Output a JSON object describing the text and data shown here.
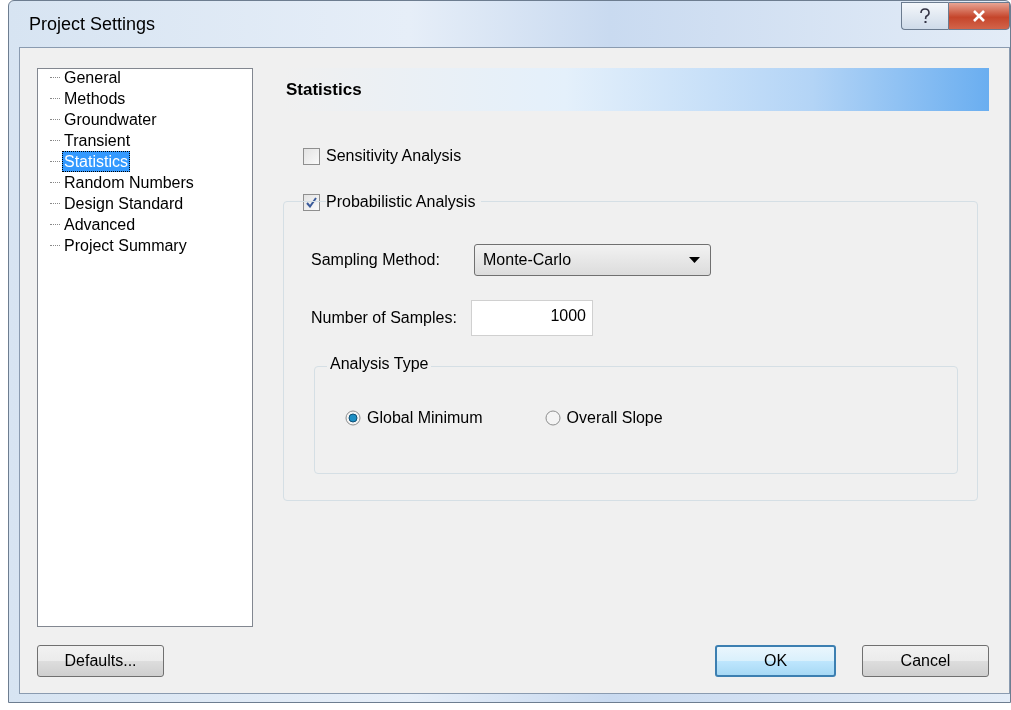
{
  "window": {
    "title": "Project Settings"
  },
  "tree": {
    "items": [
      {
        "label": "General",
        "selected": false
      },
      {
        "label": "Methods",
        "selected": false
      },
      {
        "label": "Groundwater",
        "selected": false
      },
      {
        "label": "Transient",
        "selected": false
      },
      {
        "label": "Statistics",
        "selected": true
      },
      {
        "label": "Random Numbers",
        "selected": false
      },
      {
        "label": "Design Standard",
        "selected": false
      },
      {
        "label": "Advanced",
        "selected": false
      },
      {
        "label": "Project Summary",
        "selected": false
      }
    ]
  },
  "panel": {
    "title": "Statistics",
    "sensitivity": {
      "label": "Sensitivity Analysis",
      "checked": false
    },
    "probabilistic": {
      "label": "Probabilistic Analysis",
      "checked": true,
      "sampling_method": {
        "label": "Sampling Method:",
        "value": "Monte-Carlo"
      },
      "samples": {
        "label": "Number of Samples:",
        "value": "1000"
      },
      "analysis_type": {
        "title": "Analysis Type",
        "options": [
          {
            "label": "Global Minimum",
            "selected": true
          },
          {
            "label": "Overall Slope",
            "selected": false
          }
        ]
      }
    }
  },
  "buttons": [
    {
      "label": "Defaults...",
      "default": false
    },
    {
      "label": "OK",
      "default": true
    },
    {
      "label": "Cancel",
      "default": false
    }
  ]
}
